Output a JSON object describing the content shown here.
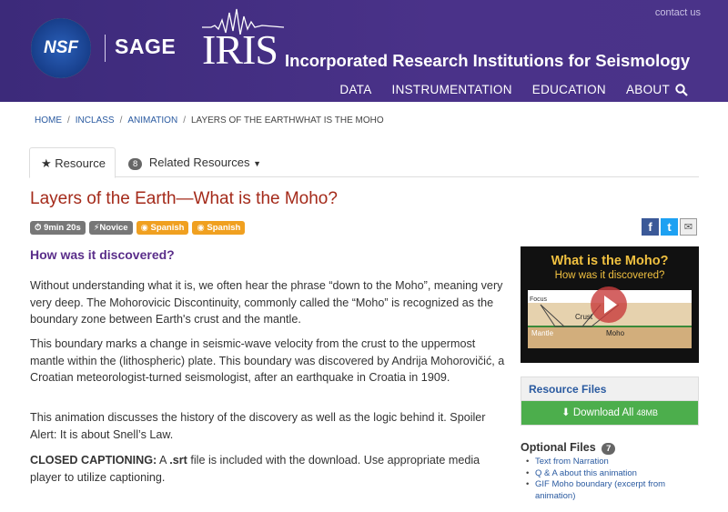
{
  "header": {
    "nsf_label": "NSF",
    "sage_label": "SAGE",
    "iris_label": "IRIS",
    "iris_full": "Incorporated Research Institutions for Seismology",
    "contact": "contact us",
    "nav": [
      "DATA",
      "INSTRUMENTATION",
      "EDUCATION",
      "ABOUT"
    ]
  },
  "breadcrumb": [
    "HOME",
    "INCLASS",
    "ANIMATION",
    "LAYERS OF THE EARTHWHAT IS THE MOHO"
  ],
  "tabs": {
    "resource": "Resource",
    "related_count": "8",
    "related": "Related Resources"
  },
  "title": "Layers of the Earth—What is the Moho?",
  "pills": {
    "duration": "9min 20s",
    "level": "Novice",
    "lang1": "Spanish",
    "lang2": "Spanish"
  },
  "share": {
    "fb": "f",
    "tw": "t",
    "email": "✉"
  },
  "subhead": "How was it discovered?",
  "paragraphs": [
    "Without understanding what it is, we often hear the phrase “down to the Moho”, meaning very very deep. The Mohorovicic Discontinuity, commonly called the “Moho” is recognized as the boundary zone between Earth's crust and the mantle.",
    "This boundary marks a change in seismic-wave velocity from the crust to the uppermost mantle within the (lithospheric) plate. This boundary was discovered by Andrija Mohorovičić, a Croatian meteorologist-turned seismologist, after an earthquake in Croatia in 1909.",
    "This animation discusses the history of the discovery as well as the logic behind it. Spoiler Alert: It is about Snell’s Law."
  ],
  "cc": {
    "label": "CLOSED CAPTIONING:",
    "pre": " A ",
    "ext": ".srt",
    "post": " file is included with the download. Use appropriate media player to utilize captioning."
  },
  "video": {
    "title": "What is the Moho?",
    "subtitle": "How was it discovered?",
    "focus": "Focus",
    "crust": "Crust",
    "mantle": "Mantle",
    "moho": "Moho"
  },
  "resource_files": {
    "heading": "Resource Files",
    "download": "Download All",
    "size": "48MB"
  },
  "optional_files": {
    "heading": "Optional Files",
    "count": "7",
    "items": [
      "Text from Narration",
      "Q & A about this animation",
      "GIF Moho boundary (excerpt from animation)"
    ]
  }
}
